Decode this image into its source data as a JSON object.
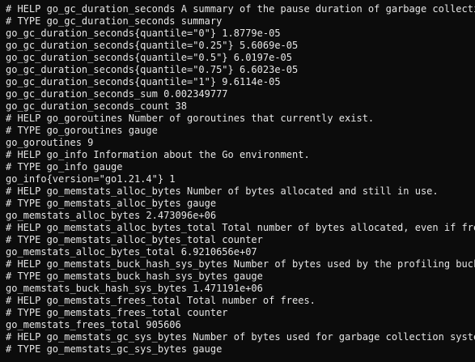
{
  "lines": [
    "# HELP go_gc_duration_seconds A summary of the pause duration of garbage collection",
    "# TYPE go_gc_duration_seconds summary",
    "go_gc_duration_seconds{quantile=\"0\"} 1.8779e-05",
    "go_gc_duration_seconds{quantile=\"0.25\"} 5.6069e-05",
    "go_gc_duration_seconds{quantile=\"0.5\"} 6.0197e-05",
    "go_gc_duration_seconds{quantile=\"0.75\"} 6.6023e-05",
    "go_gc_duration_seconds{quantile=\"1\"} 9.6114e-05",
    "go_gc_duration_seconds_sum 0.002349777",
    "go_gc_duration_seconds_count 38",
    "# HELP go_goroutines Number of goroutines that currently exist.",
    "# TYPE go_goroutines gauge",
    "go_goroutines 9",
    "# HELP go_info Information about the Go environment.",
    "# TYPE go_info gauge",
    "go_info{version=\"go1.21.4\"} 1",
    "# HELP go_memstats_alloc_bytes Number of bytes allocated and still in use.",
    "# TYPE go_memstats_alloc_bytes gauge",
    "go_memstats_alloc_bytes 2.473096e+06",
    "# HELP go_memstats_alloc_bytes_total Total number of bytes allocated, even if freed",
    "# TYPE go_memstats_alloc_bytes_total counter",
    "go_memstats_alloc_bytes_total 6.9210656e+07",
    "# HELP go_memstats_buck_hash_sys_bytes Number of bytes used by the profiling bucket",
    "# TYPE go_memstats_buck_hash_sys_bytes gauge",
    "go_memstats_buck_hash_sys_bytes 1.471191e+06",
    "# HELP go_memstats_frees_total Total number of frees.",
    "# TYPE go_memstats_frees_total counter",
    "go_memstats_frees_total 905606",
    "# HELP go_memstats_gc_sys_bytes Number of bytes used for garbage collection system",
    "# TYPE go_memstats_gc_sys_bytes gauge"
  ]
}
